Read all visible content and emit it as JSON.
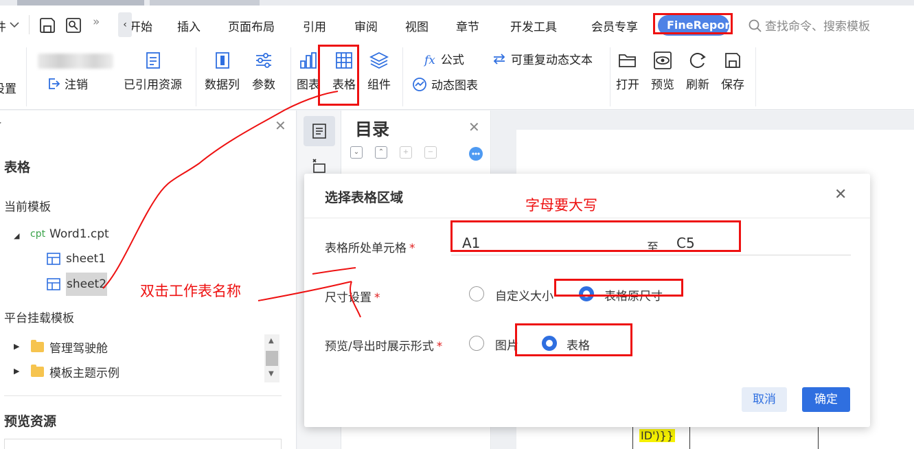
{
  "menu": {
    "file_suffix": "件",
    "tab_back_glyph": "‹",
    "tabs": [
      "开始",
      "插入",
      "页面布局",
      "引用",
      "审阅",
      "视图",
      "章节",
      "开发工具",
      "会员专享"
    ],
    "more_glyph": "»",
    "finereport": "FineReport",
    "search_placeholder": "查找命令、搜索模板"
  },
  "ribbon": {
    "settings_partial": "设置",
    "logout": "注销",
    "referenced": "已引用资源",
    "data_column": "数据列",
    "params": "参数",
    "chart": "图表",
    "table": "表格",
    "component": "组件",
    "formula": "公式",
    "dynamic_chart": "动态图表",
    "repeat_text": "可重复动态文本",
    "open": "打开",
    "preview": "预览",
    "refresh": "刷新",
    "save": "保存"
  },
  "left_panel": {
    "title": "表格",
    "current_template": "当前模板",
    "cpt_tag": "cpt",
    "file": "Word1.cpt",
    "sheets": [
      "sheet1",
      "sheet2"
    ],
    "platform_templates": "平台挂载模板",
    "folders": [
      "管理驾驶舱",
      "模板主题示例"
    ],
    "preview_resources": "预览资源"
  },
  "catalog": {
    "title": "目录"
  },
  "dialog": {
    "title": "选择表格区域",
    "cell_label": "表格所处单元格",
    "from_value": "A1",
    "to_label": "至",
    "to_value": "C5",
    "size_label": "尺寸设置",
    "size_options": [
      "自定义大小",
      "表格原尺寸"
    ],
    "size_selected": 1,
    "display_label": "预览/导出时展示形式",
    "display_options": [
      "图片",
      "表格"
    ],
    "display_selected": 1,
    "cancel": "取消",
    "ok": "确定"
  },
  "annotations": {
    "uppercase_note": "字母要大写",
    "double_click_note": "双击工作表名称"
  },
  "canvas": {
    "cell_text": "ID')}}"
  },
  "colors": {
    "accent": "#2f6fe0",
    "annotation": "#e11111",
    "finereport_tab": "#4e82e6"
  }
}
